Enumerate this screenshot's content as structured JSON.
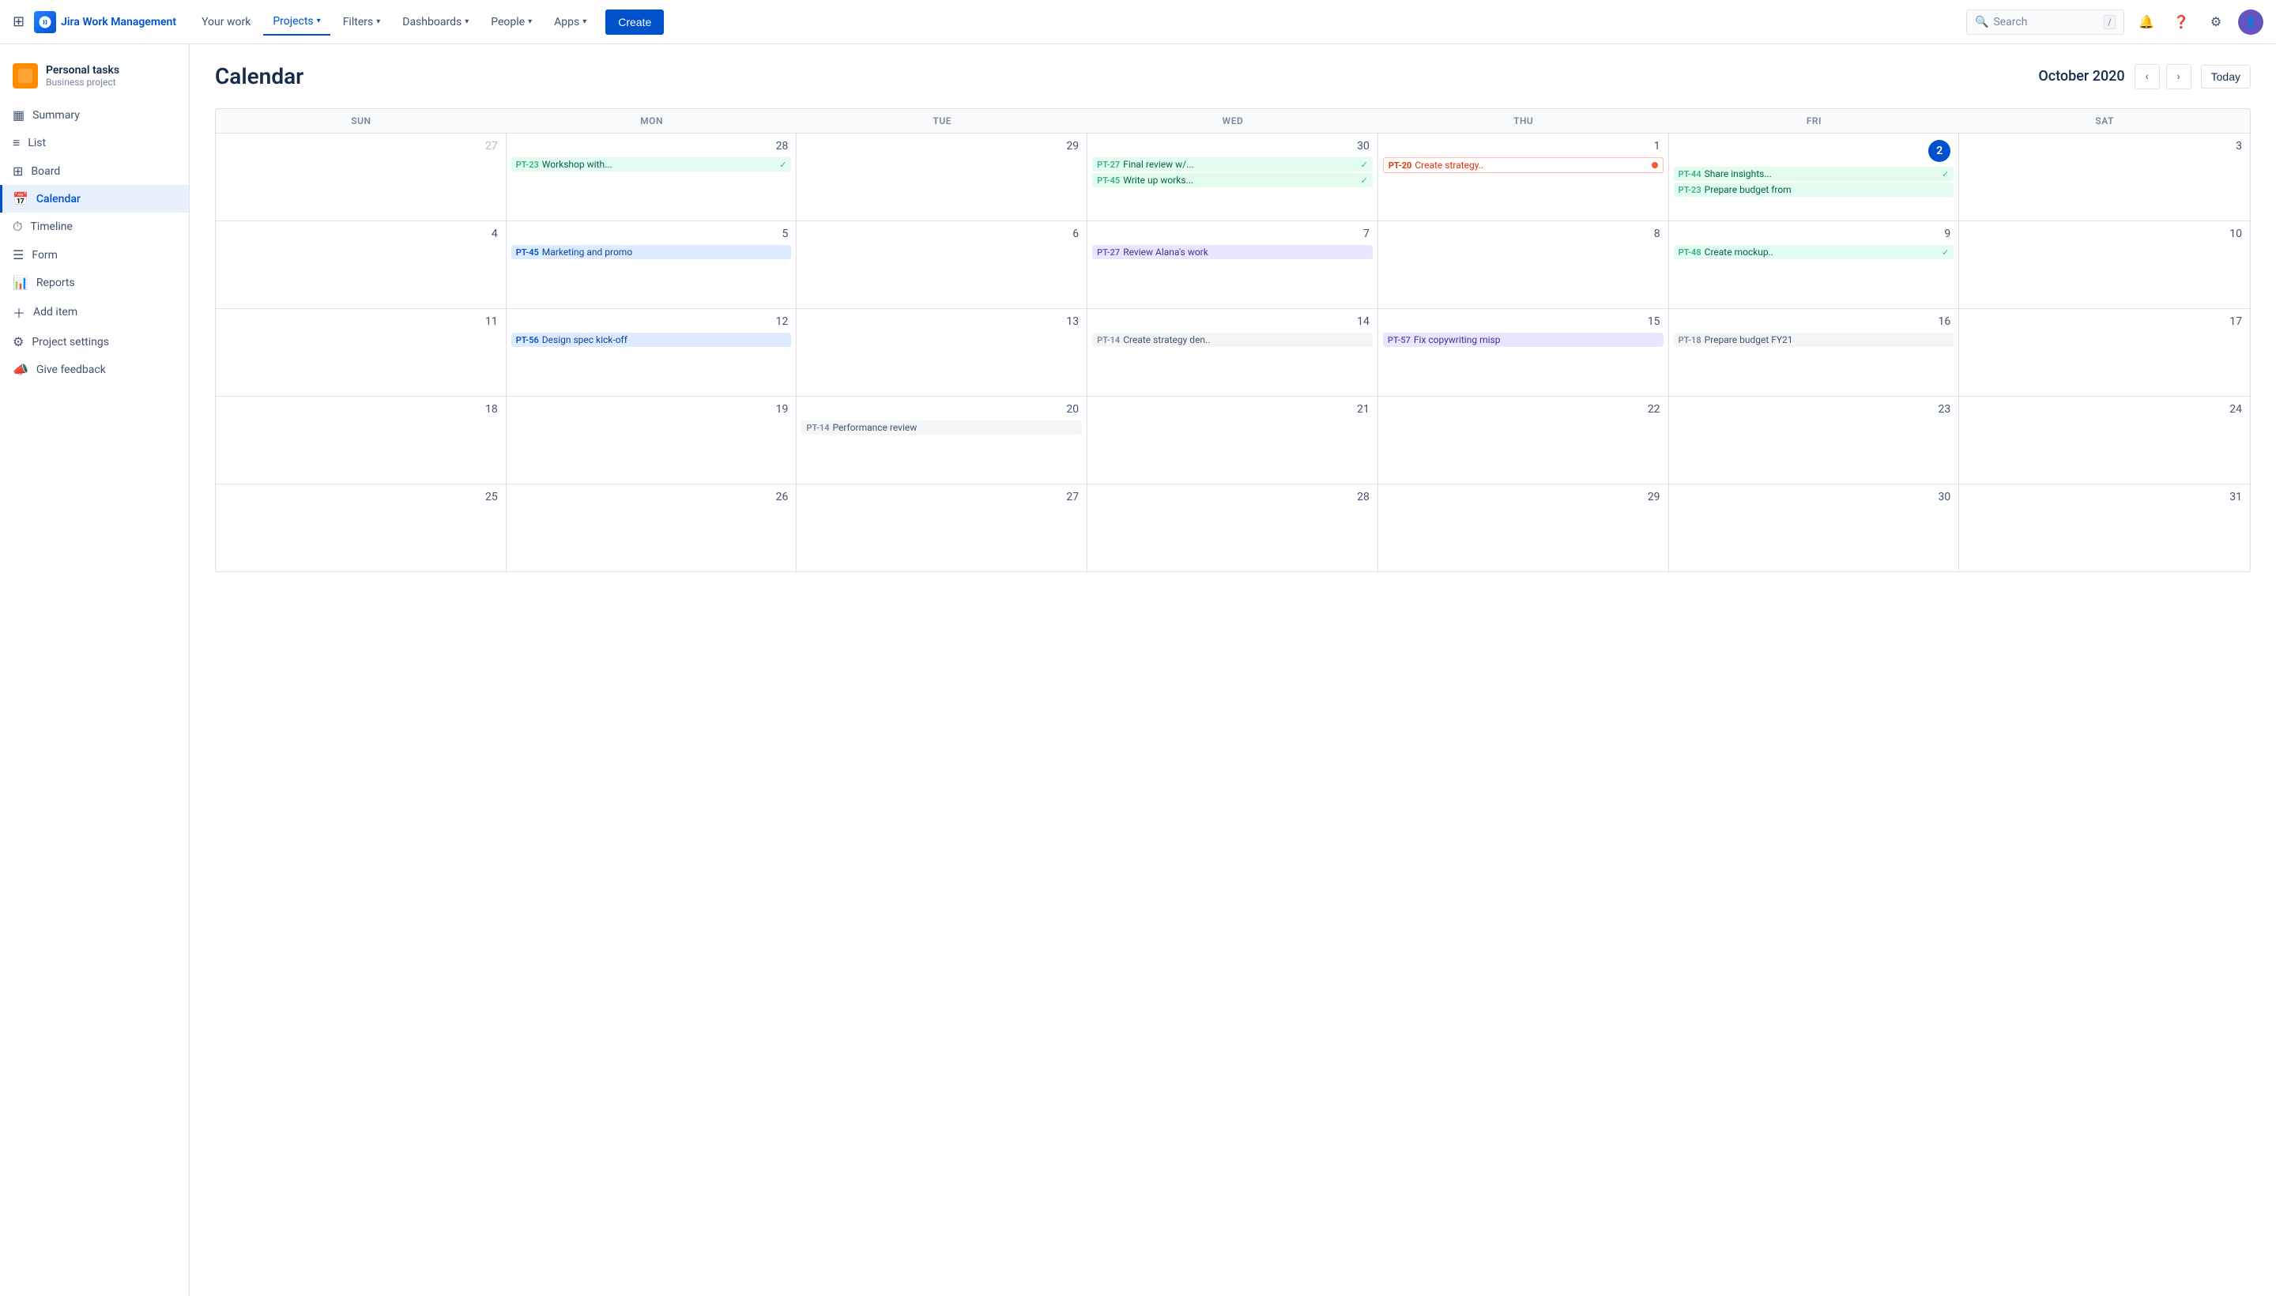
{
  "app": {
    "name": "Jira Work Management"
  },
  "topnav": {
    "logo_text": "Jira Work Management",
    "nav_items": [
      {
        "label": "Your work",
        "active": false
      },
      {
        "label": "Projects",
        "active": true
      },
      {
        "label": "Filters",
        "active": false
      },
      {
        "label": "Dashboards",
        "active": false
      },
      {
        "label": "People",
        "active": false
      },
      {
        "label": "Apps",
        "active": false
      }
    ],
    "create_label": "Create",
    "search_placeholder": "Search",
    "search_shortcut": "/"
  },
  "sidebar": {
    "project_name": "Personal tasks",
    "project_type": "Business project",
    "items": [
      {
        "id": "summary",
        "label": "Summary",
        "icon": "▦",
        "active": false
      },
      {
        "id": "list",
        "label": "List",
        "icon": "≡",
        "active": false
      },
      {
        "id": "board",
        "label": "Board",
        "icon": "⊞",
        "active": false
      },
      {
        "id": "calendar",
        "label": "Calendar",
        "icon": "📅",
        "active": true
      },
      {
        "id": "timeline",
        "label": "Timeline",
        "icon": "⏱",
        "active": false
      },
      {
        "id": "form",
        "label": "Form",
        "icon": "☰",
        "active": false
      },
      {
        "id": "reports",
        "label": "Reports",
        "icon": "📊",
        "active": false
      },
      {
        "id": "add-item",
        "label": "Add item",
        "icon": "＋",
        "active": false
      },
      {
        "id": "project-settings",
        "label": "Project settings",
        "icon": "⚙",
        "active": false
      },
      {
        "id": "give-feedback",
        "label": "Give feedback",
        "icon": "📣",
        "active": false
      }
    ]
  },
  "calendar": {
    "title": "Calendar",
    "month_year": "October 2020",
    "today_label": "Today",
    "day_headers": [
      "SUN",
      "MON",
      "TUE",
      "WED",
      "THU",
      "FRI",
      "SAT"
    ],
    "weeks": [
      {
        "days": [
          {
            "date": "27",
            "other_month": true,
            "events": []
          },
          {
            "date": "28",
            "other_month": false,
            "events": [
              {
                "id": "PT-23",
                "text": "Workshop with...",
                "color": "green",
                "check": true
              }
            ]
          },
          {
            "date": "29",
            "other_month": false,
            "events": []
          },
          {
            "date": "30",
            "other_month": false,
            "events": [
              {
                "id": "PT-27",
                "text": "Final review w/...",
                "color": "green",
                "check": true
              },
              {
                "id": "PT-45",
                "text": "Write up works...",
                "color": "green",
                "check": true
              }
            ]
          },
          {
            "date": "1",
            "other_month": false,
            "events": [
              {
                "id": "PT-20",
                "text": "Create strategy..",
                "color": "red",
                "dot": true
              }
            ]
          },
          {
            "date": "2",
            "other_month": false,
            "today": true,
            "events": [
              {
                "id": "PT-44",
                "text": "Share insights...",
                "color": "green",
                "check": true
              },
              {
                "id": "PT-23",
                "text": "Prepare budget from",
                "color": "green"
              }
            ]
          },
          {
            "date": "3",
            "other_month": false,
            "events": []
          }
        ]
      },
      {
        "days": [
          {
            "date": "4",
            "other_month": false,
            "events": []
          },
          {
            "date": "5",
            "other_month": false,
            "events": [
              {
                "id": "PT-45",
                "text": "Marketing and promo",
                "color": "blue-light"
              }
            ]
          },
          {
            "date": "6",
            "other_month": false,
            "events": []
          },
          {
            "date": "7",
            "other_month": false,
            "events": [
              {
                "id": "PT-27",
                "text": "Review Alana's work",
                "color": "purple"
              }
            ]
          },
          {
            "date": "8",
            "other_month": false,
            "events": []
          },
          {
            "date": "9",
            "other_month": false,
            "events": [
              {
                "id": "PT-48",
                "text": "Create mockup..",
                "color": "green",
                "check": true
              }
            ]
          },
          {
            "date": "10",
            "other_month": false,
            "events": []
          }
        ]
      },
      {
        "days": [
          {
            "date": "11",
            "other_month": false,
            "events": []
          },
          {
            "date": "12",
            "other_month": false,
            "events": [
              {
                "id": "PT-56",
                "text": "Design spec kick-off",
                "color": "blue-light"
              }
            ]
          },
          {
            "date": "13",
            "other_month": false,
            "events": []
          },
          {
            "date": "14",
            "other_month": false,
            "events": [
              {
                "id": "PT-14",
                "text": "Create strategy den..",
                "color": "gray"
              }
            ]
          },
          {
            "date": "15",
            "other_month": false,
            "events": [
              {
                "id": "PT-57",
                "text": "Fix copywriting misp",
                "color": "purple"
              }
            ]
          },
          {
            "date": "16",
            "other_month": false,
            "events": [
              {
                "id": "PT-18",
                "text": "Prepare budget FY21",
                "color": "gray"
              }
            ]
          },
          {
            "date": "17",
            "other_month": false,
            "events": []
          }
        ]
      },
      {
        "days": [
          {
            "date": "18",
            "other_month": false,
            "events": []
          },
          {
            "date": "19",
            "other_month": false,
            "events": []
          },
          {
            "date": "20",
            "other_month": false,
            "events": [
              {
                "id": "PT-14",
                "text": "Performance review",
                "color": "gray"
              }
            ]
          },
          {
            "date": "21",
            "other_month": false,
            "events": []
          },
          {
            "date": "22",
            "other_month": false,
            "events": []
          },
          {
            "date": "23",
            "other_month": false,
            "events": []
          },
          {
            "date": "24",
            "other_month": false,
            "events": []
          }
        ]
      },
      {
        "days": [
          {
            "date": "25",
            "other_month": false,
            "events": []
          },
          {
            "date": "26",
            "other_month": false,
            "events": []
          },
          {
            "date": "27",
            "other_month": false,
            "events": []
          },
          {
            "date": "28",
            "other_month": false,
            "events": []
          },
          {
            "date": "29",
            "other_month": false,
            "events": []
          },
          {
            "date": "30",
            "other_month": false,
            "events": []
          },
          {
            "date": "31",
            "other_month": false,
            "events": []
          }
        ]
      }
    ]
  }
}
